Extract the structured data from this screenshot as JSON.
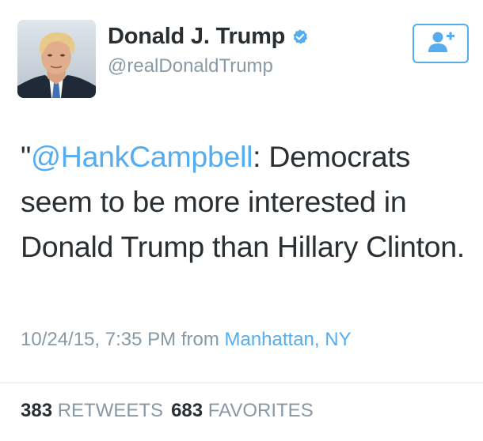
{
  "user": {
    "display_name": "Donald J. Trump",
    "handle": "@realDonaldTrump",
    "verified_icon": "verified-badge-icon"
  },
  "follow_button": {
    "icon": "follow-user-plus-icon"
  },
  "tweet": {
    "text_open_quote": "\"",
    "mention": "@HankCampbell",
    "text_body": ": Democrats seem to be more interested in Donald Trump than Hillary Clinton."
  },
  "meta": {
    "timestamp": "10/24/15, 7:35 PM",
    "from_label": "from",
    "location": "Manhattan, NY"
  },
  "stats": {
    "retweets_count": "383",
    "retweets_label": "RETWEETS",
    "favorites_count": "683",
    "favorites_label": "FAVORITES"
  },
  "colors": {
    "accent": "#55acee",
    "text": "#292f33",
    "muted": "#8899a6",
    "divider": "#e1e8ed"
  }
}
